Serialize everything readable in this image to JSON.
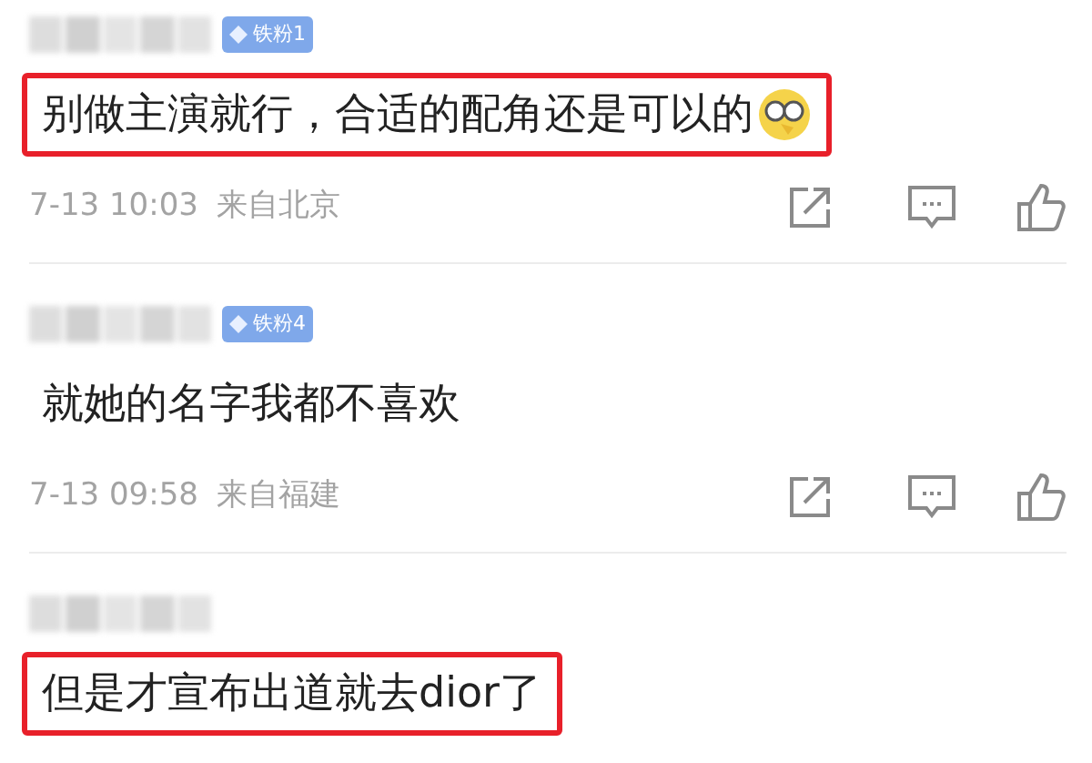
{
  "comments": [
    {
      "badge": "铁粉1",
      "text": "别做主演就行，合适的配角还是可以的",
      "emoji": true,
      "highlighted": true,
      "time": "7-13 10:03",
      "location": "来自北京"
    },
    {
      "badge": "铁粉4",
      "text": "就她的名字我都不喜欢",
      "emoji": false,
      "highlighted": false,
      "time": "7-13 09:58",
      "location": "来自福建"
    },
    {
      "text": "但是才宣布出道就去dior了",
      "emoji": false,
      "highlighted": true
    }
  ]
}
